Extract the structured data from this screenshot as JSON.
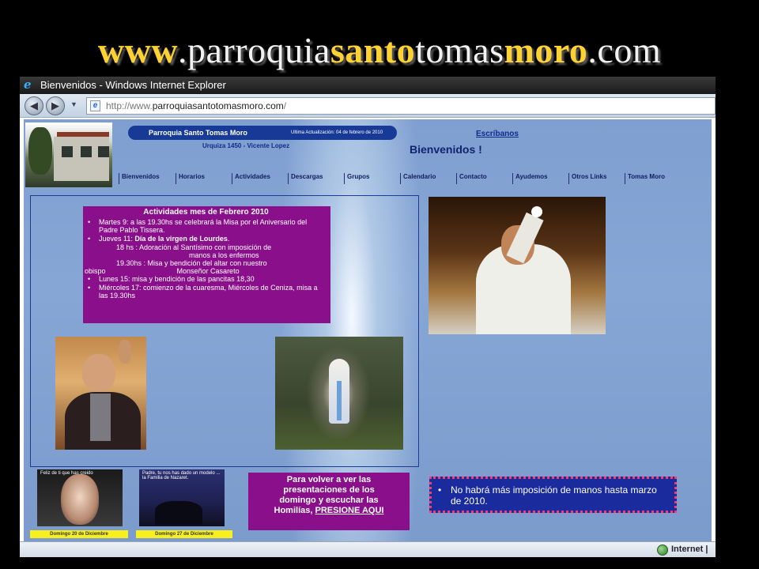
{
  "slide_title": {
    "p1": "www",
    "p2": ".parroquia",
    "p3": "santo",
    "p4": "tomas",
    "p5": "moro",
    "p6": ".com"
  },
  "browser": {
    "window_title": "Bienvenidos - Windows Internet Explorer",
    "address_protocol": "http://www.",
    "address_host": "parroquiasantotomasmoro.com",
    "address_path": "/",
    "status_zone": "Internet |"
  },
  "site": {
    "header": {
      "name": "Parroquia Santo Tomas Moro",
      "last_update": "Ultima Actualización: 04 de febrero de 2010",
      "address": "Urquiza 1450 - Vicente Lopez",
      "contact_link": "Escríbanos",
      "welcome": "Bienvenidos !"
    },
    "menu": [
      "Bienvenidos",
      "Horarios",
      "Actividades",
      "Descargas",
      "Grupos",
      "Calendario",
      "Contacto",
      "Ayudemos",
      "Otros Links",
      "Tomas Moro"
    ],
    "activities": {
      "title": "Actividades mes de Febrero 2010",
      "item1": "Martes 9: a las 19.30hs se celebrará la Misa por el Aniversario del Padre Pablo Tissera.",
      "item2_prefix": "Jueves 11: ",
      "item2_bold": "Día de la virgen de Lourdes",
      "item2_suffix": ".",
      "sub1_a": "18 hs    : Adoración al Santísimo con imposición de",
      "sub1_b": "manos a los enfermos",
      "sub2_a": "19.30hs : Misa y bendición del altar con nuestro",
      "sub2_obispo": "obispo",
      "sub2_b": "Monseñor Casareto",
      "item3": "Lunes 15:  misa y bendición de las pancitas 18,30",
      "item4": "Miércoles 17: comienzo de la cuaresma, Miércoles de Ceniza, misa a las 19.30hs"
    },
    "thumbs": {
      "thumb1_text": "Feliz de ti que has creido",
      "thumb1_caption": "Domingo 20  de Diciembre",
      "thumb2_text": "Padre, tu nos has dado un modelo ... la Familia de Nazaret.",
      "thumb2_caption": "Domingo 27 de Diciembre"
    },
    "homilias": {
      "line1": "Para volver a ver las",
      "line2": "presentaciones de los",
      "line3": "domingo y escuchar las",
      "line4_prefix": "Homilías, ",
      "line4_link": "PRESIONE AQUI"
    },
    "notice": "No habrá más imposición de manos hasta marzo de 2010."
  }
}
